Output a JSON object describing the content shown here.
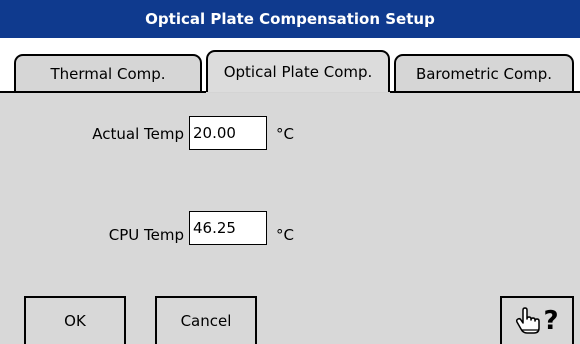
{
  "window": {
    "title": "Optical Plate Compensation Setup"
  },
  "tabs": [
    {
      "label": "Thermal Comp.",
      "active": false
    },
    {
      "label": "Optical Plate Comp.",
      "active": true
    },
    {
      "label": "Barometric Comp.",
      "active": false
    }
  ],
  "form": {
    "actual_temp": {
      "label": "Actual Temp",
      "value": "20.00",
      "unit": "°C"
    },
    "cpu_temp": {
      "label": "CPU Temp",
      "value": "46.25",
      "unit": "°C"
    }
  },
  "buttons": {
    "ok": "OK",
    "cancel": "Cancel",
    "help_icon": "hand-pointer-question-icon"
  },
  "colors": {
    "titlebar": "#0f3a8e",
    "panel": "#d8d8d8",
    "tab_bg": "#ffffff"
  }
}
